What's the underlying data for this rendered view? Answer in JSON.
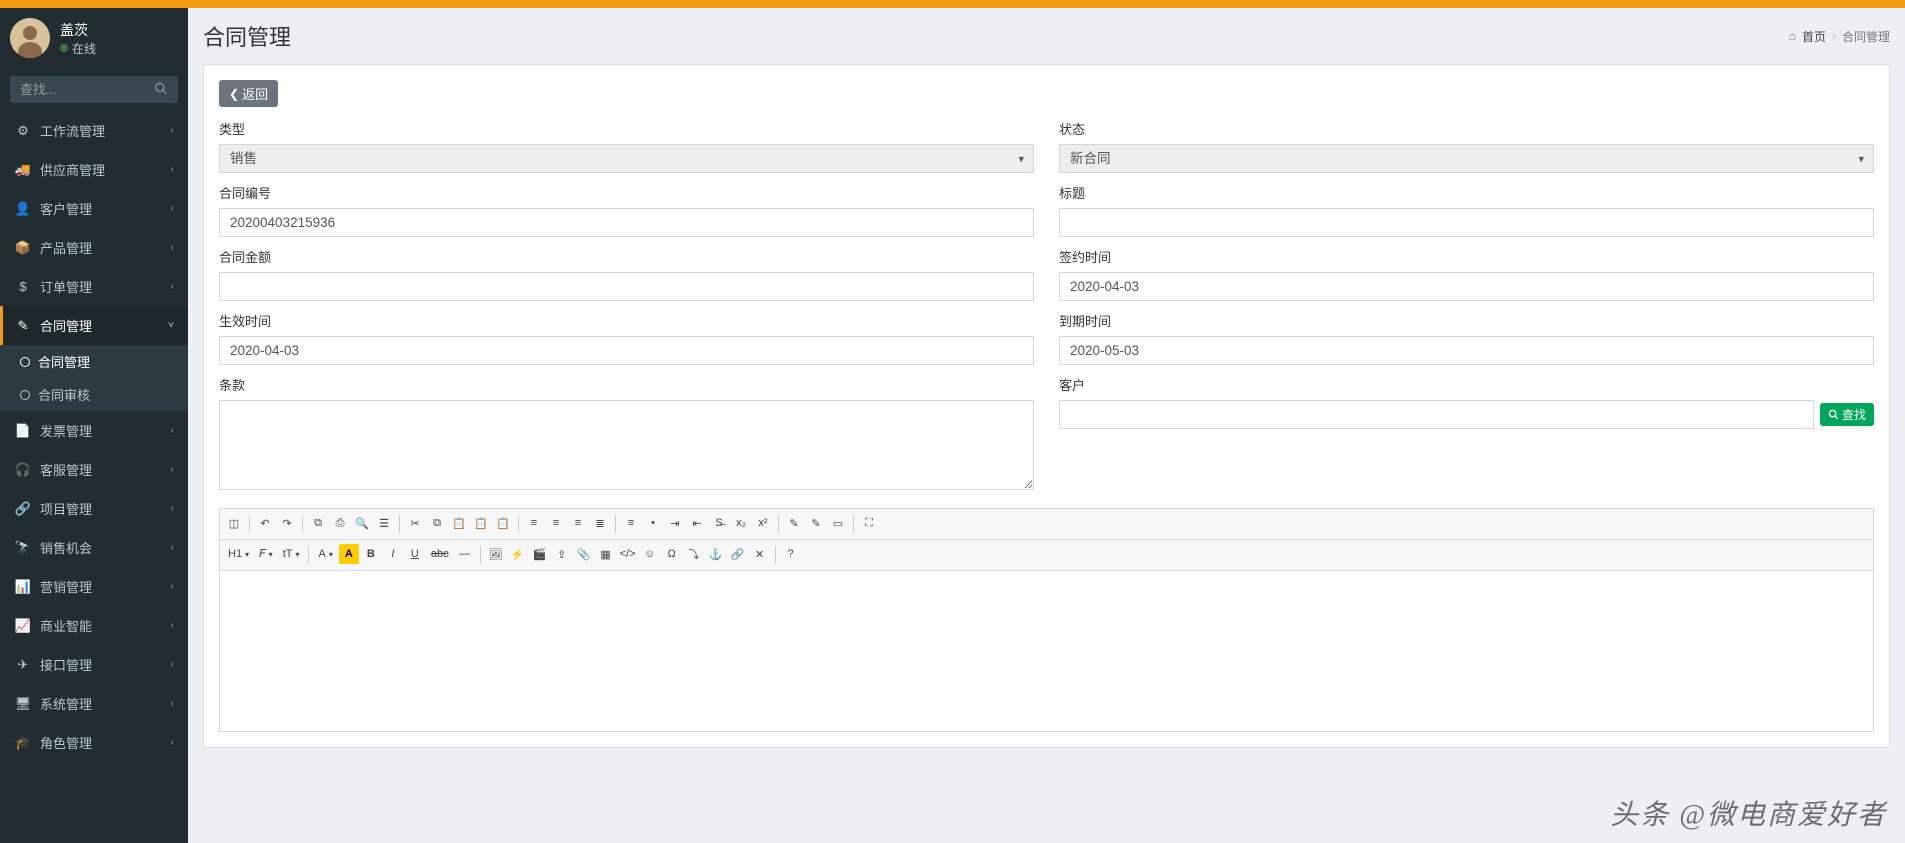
{
  "user": {
    "name": "盖茨",
    "status": "在线"
  },
  "search": {
    "placeholder": "查找..."
  },
  "sidebar": {
    "items": [
      {
        "icon": "⚙",
        "label": "工作流管理"
      },
      {
        "icon": "🚚",
        "label": "供应商管理"
      },
      {
        "icon": "👤",
        "label": "客户管理"
      },
      {
        "icon": "📦",
        "label": "产品管理"
      },
      {
        "icon": "$",
        "label": "订单管理"
      },
      {
        "icon": "✎",
        "label": "合同管理",
        "active": true,
        "children": [
          {
            "label": "合同管理",
            "selected": true
          },
          {
            "label": "合同审核"
          }
        ]
      },
      {
        "icon": "📄",
        "label": "发票管理"
      },
      {
        "icon": "🎧",
        "label": "客服管理"
      },
      {
        "icon": "🔗",
        "label": "项目管理"
      },
      {
        "icon": "🔭",
        "label": "销售机会"
      },
      {
        "icon": "📊",
        "label": "营销管理"
      },
      {
        "icon": "📈",
        "label": "商业智能"
      },
      {
        "icon": "✈",
        "label": "接口管理"
      },
      {
        "icon": "🖥",
        "label": "系统管理"
      },
      {
        "icon": "🎓",
        "label": "角色管理"
      }
    ]
  },
  "page": {
    "title": "合同管理",
    "breadcrumb": {
      "home": "首页",
      "current": "合同管理"
    },
    "back": "返回"
  },
  "form": {
    "type": {
      "label": "类型",
      "value": "销售"
    },
    "status": {
      "label": "状态",
      "value": "新合同"
    },
    "code": {
      "label": "合同编号",
      "value": "20200403215936"
    },
    "subject": {
      "label": "标题",
      "value": ""
    },
    "amount": {
      "label": "合同金额",
      "value": ""
    },
    "sign_date": {
      "label": "签约时间",
      "value": "2020-04-03"
    },
    "effect_date": {
      "label": "生效时间",
      "value": "2020-04-03"
    },
    "expire_date": {
      "label": "到期时间",
      "value": "2020-05-03"
    },
    "terms": {
      "label": "条款",
      "value": ""
    },
    "customer": {
      "label": "客户",
      "value": "",
      "find": "查找"
    }
  },
  "editor_toolbar": {
    "r1": [
      "src",
      "|",
      "undo",
      "redo",
      "|",
      "cut2",
      "print",
      "preview",
      "tmpl",
      "|",
      "cut",
      "copy",
      "paste",
      "paste-txt",
      "paste-word",
      "|",
      "j-left",
      "j-center",
      "j-right",
      "j-full",
      "|",
      "ol",
      "ul",
      "indent",
      "outdent",
      "strike2",
      "sub",
      "sup",
      "|",
      "hl",
      "color2",
      "select-all",
      "|",
      "fullscreen"
    ],
    "r2": [
      "H1",
      "font",
      "size",
      "|",
      "fgA",
      "bgA",
      "bold",
      "italic",
      "underline",
      "strike",
      "hr",
      "|",
      "img",
      "flash",
      "media",
      "upload",
      "attach",
      "table",
      "code",
      "emoji",
      "specialchar",
      "pagebreak",
      "anchor",
      "link",
      "unlink",
      "|",
      "help"
    ]
  },
  "watermark": "头条 @微电商爱好者"
}
